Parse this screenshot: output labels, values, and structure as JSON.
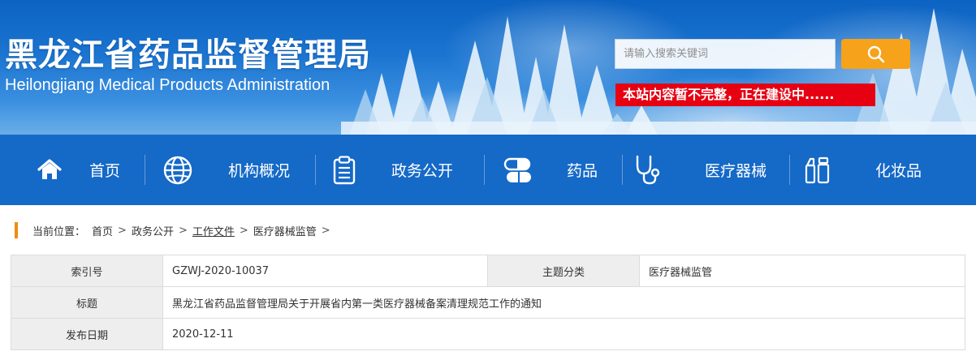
{
  "header": {
    "title": "黑龙江省药品监督管理局",
    "subtitle": "Heilongjiang Medical Products Administration",
    "search_placeholder": "请输入搜索关键词",
    "notice": "本站内容暂不完整，正在建设中......"
  },
  "nav": {
    "items": [
      {
        "label": "首页",
        "icon": "home-icon"
      },
      {
        "label": "机构概况",
        "icon": "globe-icon"
      },
      {
        "label": "政务公开",
        "icon": "clipboard-icon"
      },
      {
        "label": "药品",
        "icon": "capsule-icon"
      },
      {
        "label": "医疗器械",
        "icon": "stethoscope-icon"
      },
      {
        "label": "化妆品",
        "icon": "cosmetics-icon"
      }
    ]
  },
  "breadcrumb": {
    "prefix": "当前位置：",
    "items": [
      "首页",
      "政务公开",
      "工作文件",
      "医疗器械监管"
    ],
    "separator": ">"
  },
  "info": {
    "index_label": "索引号",
    "index_value": "GZWJ-2020-10037",
    "topic_label": "主题分类",
    "topic_value": "医疗器械监管",
    "title_label": "标题",
    "title_value": "黑龙江省药品监督管理局关于开展省内第一类医疗器械备案清理规范工作的通知",
    "date_label": "发布日期",
    "date_value": "2020-12-11"
  },
  "colors": {
    "nav_bg": "#1569c7",
    "search_button": "#f6a21a",
    "notice_bg": "#e60012",
    "breadcrumb_bar": "#f08c10"
  }
}
